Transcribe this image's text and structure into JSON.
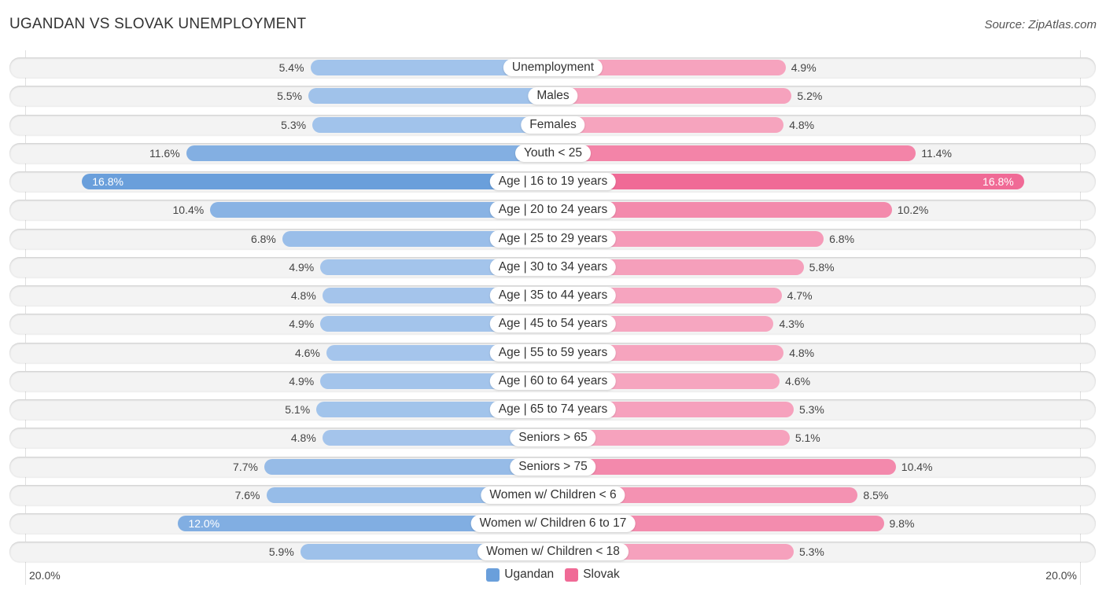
{
  "chart_data": {
    "type": "bar",
    "orientation": "horizontal-diverging",
    "title": "UGANDAN VS SLOVAK UNEMPLOYMENT",
    "source": "Source: ZipAtlas.com",
    "categories": [
      "Unemployment",
      "Males",
      "Females",
      "Youth < 25",
      "Age | 16 to 19 years",
      "Age | 20 to 24 years",
      "Age | 25 to 29 years",
      "Age | 30 to 34 years",
      "Age | 35 to 44 years",
      "Age | 45 to 54 years",
      "Age | 55 to 59 years",
      "Age | 60 to 64 years",
      "Age | 65 to 74 years",
      "Seniors > 65",
      "Seniors > 75",
      "Women w/ Children < 6",
      "Women w/ Children 6 to 17",
      "Women w/ Children < 18"
    ],
    "series": [
      {
        "name": "Ugandan",
        "color": "#6a9fdb",
        "values": [
          5.4,
          5.5,
          5.3,
          11.6,
          16.8,
          10.4,
          6.8,
          4.9,
          4.8,
          4.9,
          4.6,
          4.9,
          5.1,
          4.8,
          7.7,
          7.6,
          12.0,
          5.9
        ],
        "labels": [
          "5.4%",
          "5.5%",
          "5.3%",
          "11.6%",
          "16.8%",
          "10.4%",
          "6.8%",
          "4.9%",
          "4.8%",
          "4.9%",
          "4.6%",
          "4.9%",
          "5.1%",
          "4.8%",
          "7.7%",
          "7.6%",
          "12.0%",
          "5.9%"
        ]
      },
      {
        "name": "Slovak",
        "color": "#f06a96",
        "values": [
          4.9,
          5.2,
          4.8,
          11.4,
          16.8,
          10.2,
          6.8,
          5.8,
          4.7,
          4.3,
          4.8,
          4.6,
          5.3,
          5.1,
          10.4,
          8.5,
          9.8,
          5.3
        ],
        "labels": [
          "4.9%",
          "5.2%",
          "4.8%",
          "11.4%",
          "16.8%",
          "10.2%",
          "6.8%",
          "5.8%",
          "4.7%",
          "4.3%",
          "4.8%",
          "4.6%",
          "5.3%",
          "5.1%",
          "10.4%",
          "8.5%",
          "9.8%",
          "5.3%"
        ]
      }
    ],
    "xlim": [
      -20,
      20
    ],
    "axis_labels": {
      "left": "20.0%",
      "right": "20.0%"
    },
    "legend": {
      "position": "bottom-center",
      "entries": [
        "Ugandan",
        "Slovak"
      ]
    },
    "grid": false
  }
}
